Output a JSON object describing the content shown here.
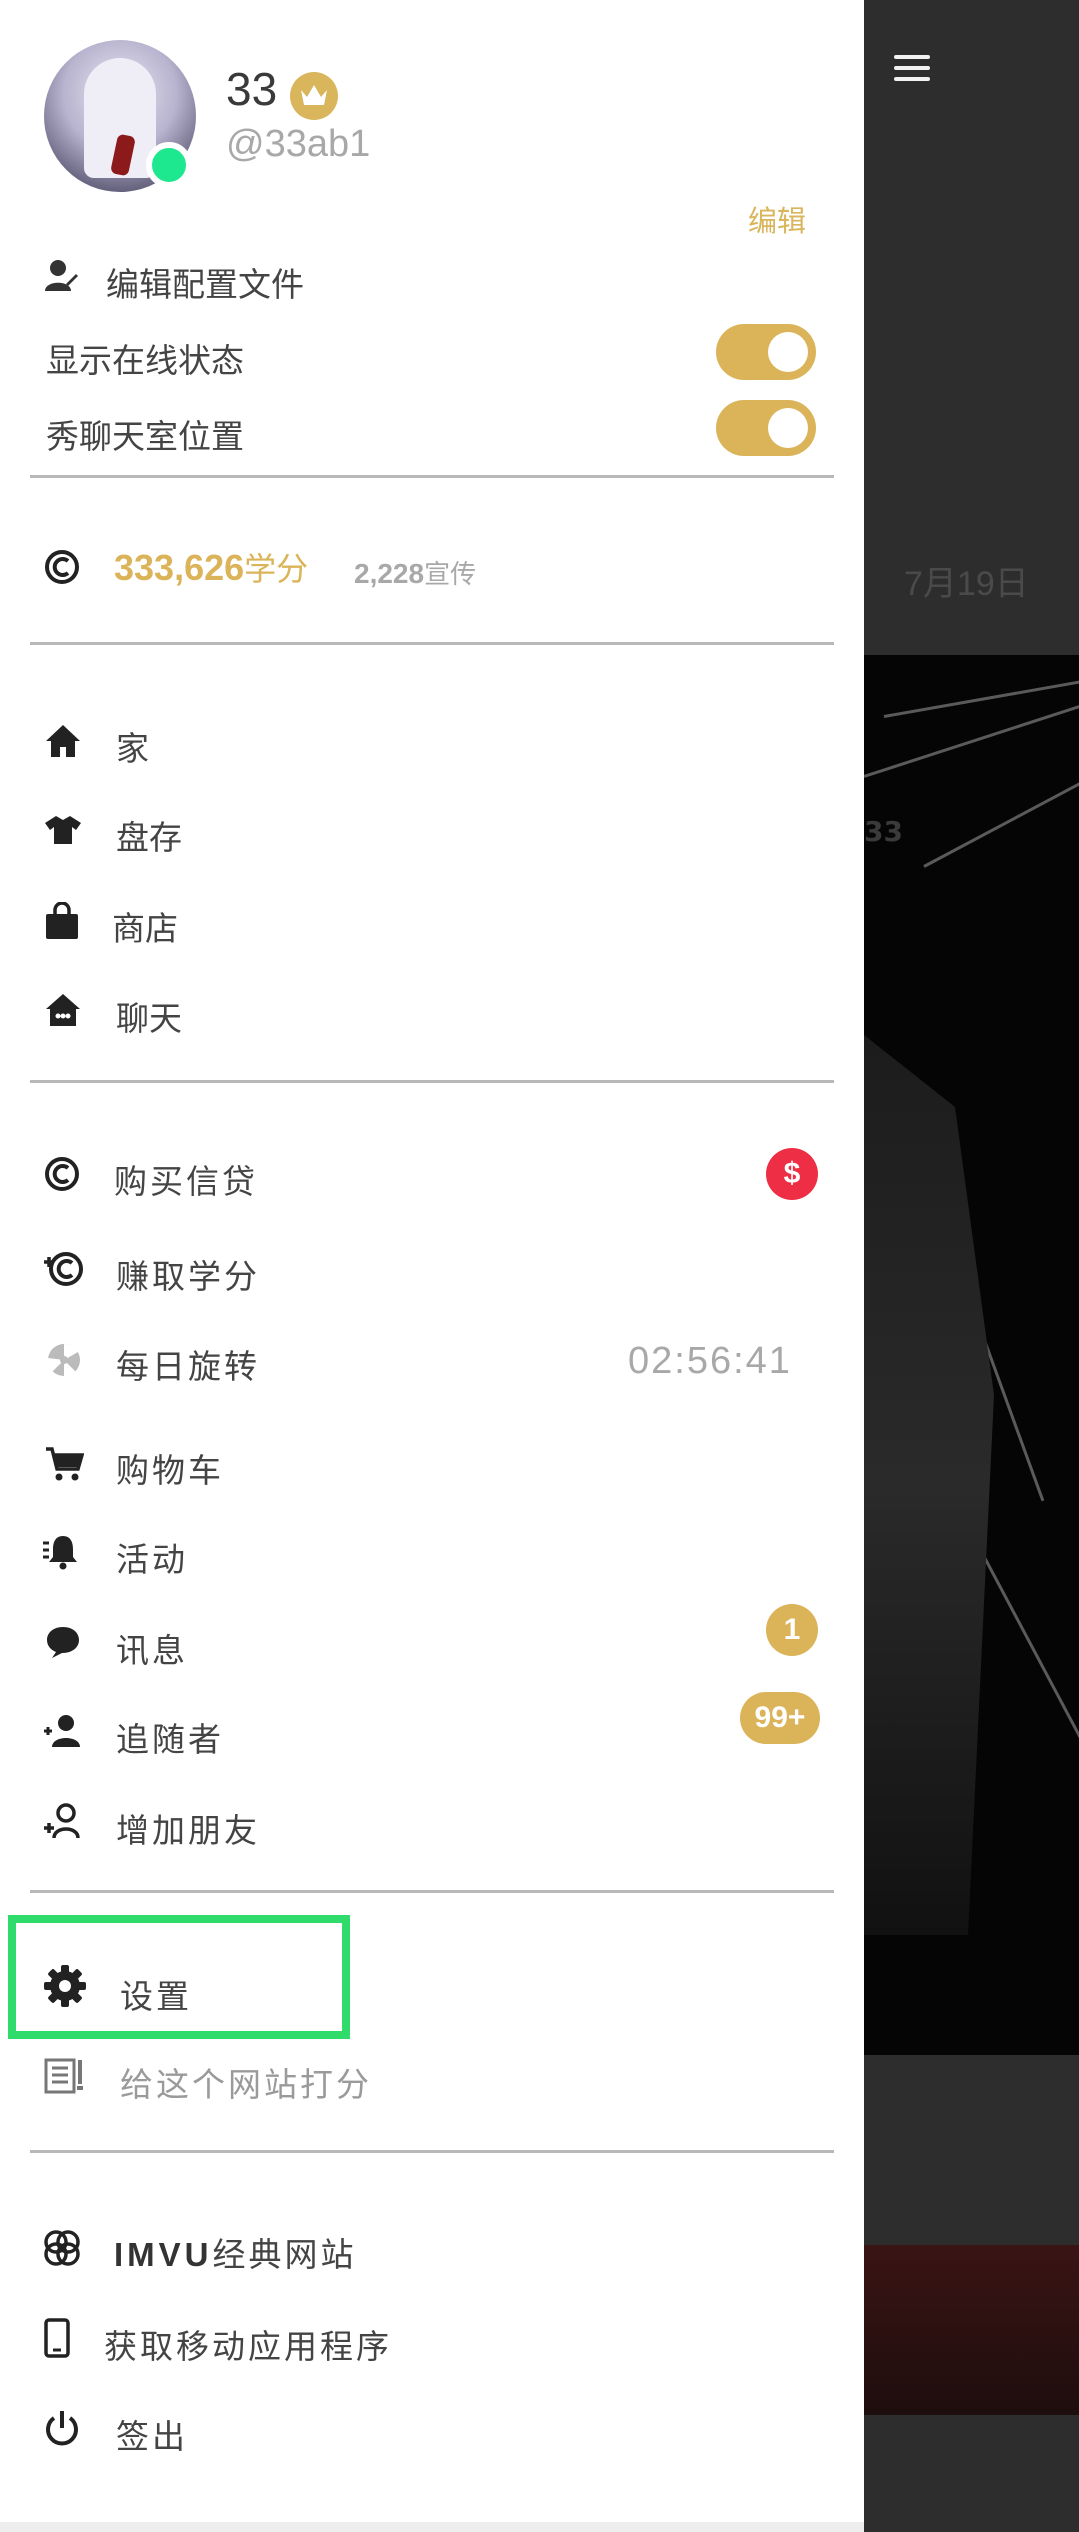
{
  "profile": {
    "username": "33",
    "handle": "@33ab1",
    "edit_label": "编辑",
    "online": true
  },
  "settings_rows": {
    "edit_profile": "编辑配置文件",
    "show_online": "显示在线状态",
    "show_chat_location": "秀聊天室位置"
  },
  "toggles": {
    "show_online": true,
    "show_chat_location": true
  },
  "balance": {
    "credits": "333,626",
    "credits_unit": "学分",
    "promo": "2,228",
    "promo_unit": "宣传"
  },
  "nav": {
    "home": "家",
    "inventory": "盘存",
    "shop": "商店",
    "chat": "聊天"
  },
  "actions": {
    "buy_credits": "购买信贷",
    "buy_credits_badge": "$",
    "earn_credits": "赚取学分",
    "daily_spin": "每日旋转",
    "daily_spin_timer": "02:56:41",
    "cart": "购物车",
    "activity": "活动",
    "messages": "讯息",
    "messages_badge": "1",
    "followers": "追随者",
    "followers_badge": "99+",
    "add_friends": "增加朋友"
  },
  "footer_menu": {
    "settings": "设置",
    "rate_site": "给这个网站打分",
    "imvu_brand": "IMVU",
    "classic_site": "经典网站",
    "get_mobile_app": "获取移动应用程序",
    "sign_out": "签出"
  },
  "background": {
    "date": "7月19日",
    "photo_tag": "33"
  },
  "colors": {
    "accent_gold": "#dbb459",
    "online_green": "#1de88f",
    "badge_red": "#ee2e45",
    "highlight_green": "#2fdb6a"
  }
}
